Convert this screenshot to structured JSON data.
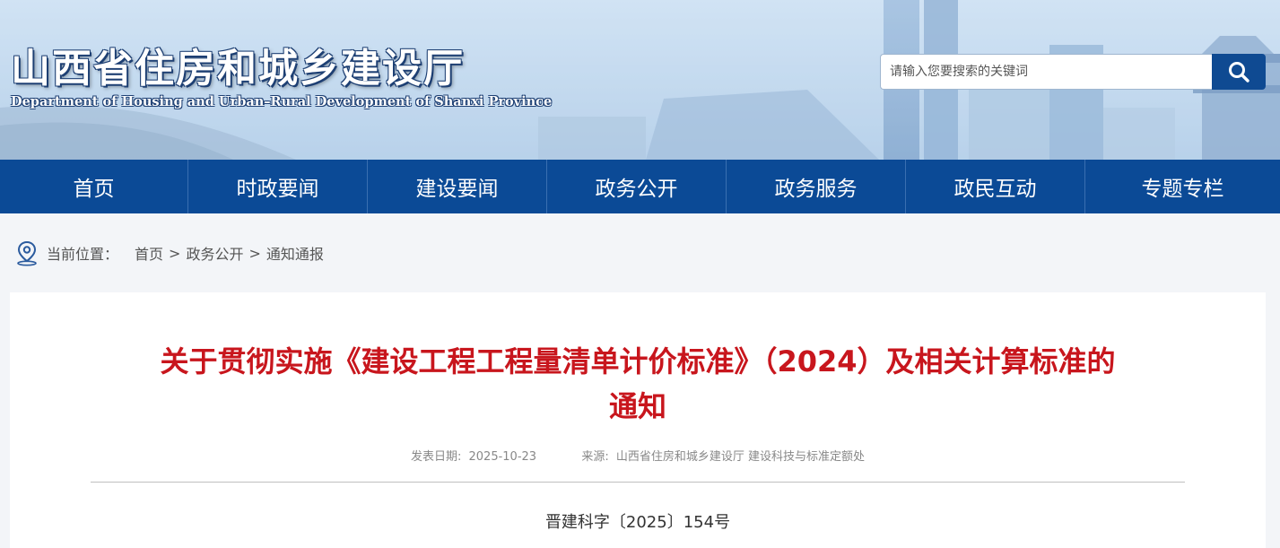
{
  "header": {
    "site_title": "山西省住房和城乡建设厅",
    "site_subtitle": "Department of Housing and Urban–Rural Development of Shanxi Province",
    "search_placeholder": "请输入您要搜索的关键词",
    "search_icon": "search-icon"
  },
  "nav": {
    "items": [
      "首页",
      "时政要闻",
      "建设要闻",
      "政务公开",
      "政务服务",
      "政民互动",
      "专题专栏"
    ]
  },
  "breadcrumb": {
    "label": "当前位置：",
    "items": [
      "首页",
      "政务公开",
      "通知通报"
    ],
    "separator": ">",
    "icon": "location-pin-icon"
  },
  "article": {
    "title_line1": "关于贯彻实施《建设工程工程量清单计价标准》（2024）及相关计算标准的",
    "title_line2": "通知",
    "date_label": "发表日期:",
    "date_value": "2025-10-23",
    "source_label": "来源:",
    "source_value": "山西省住房和城乡建设厅 建设科技与标准定额处",
    "doc_number": "晋建科字〔2025〕154号"
  },
  "colors": {
    "nav_bg": "#0b4a96",
    "title_red": "#c8161d",
    "search_btn": "#0f4a92"
  }
}
